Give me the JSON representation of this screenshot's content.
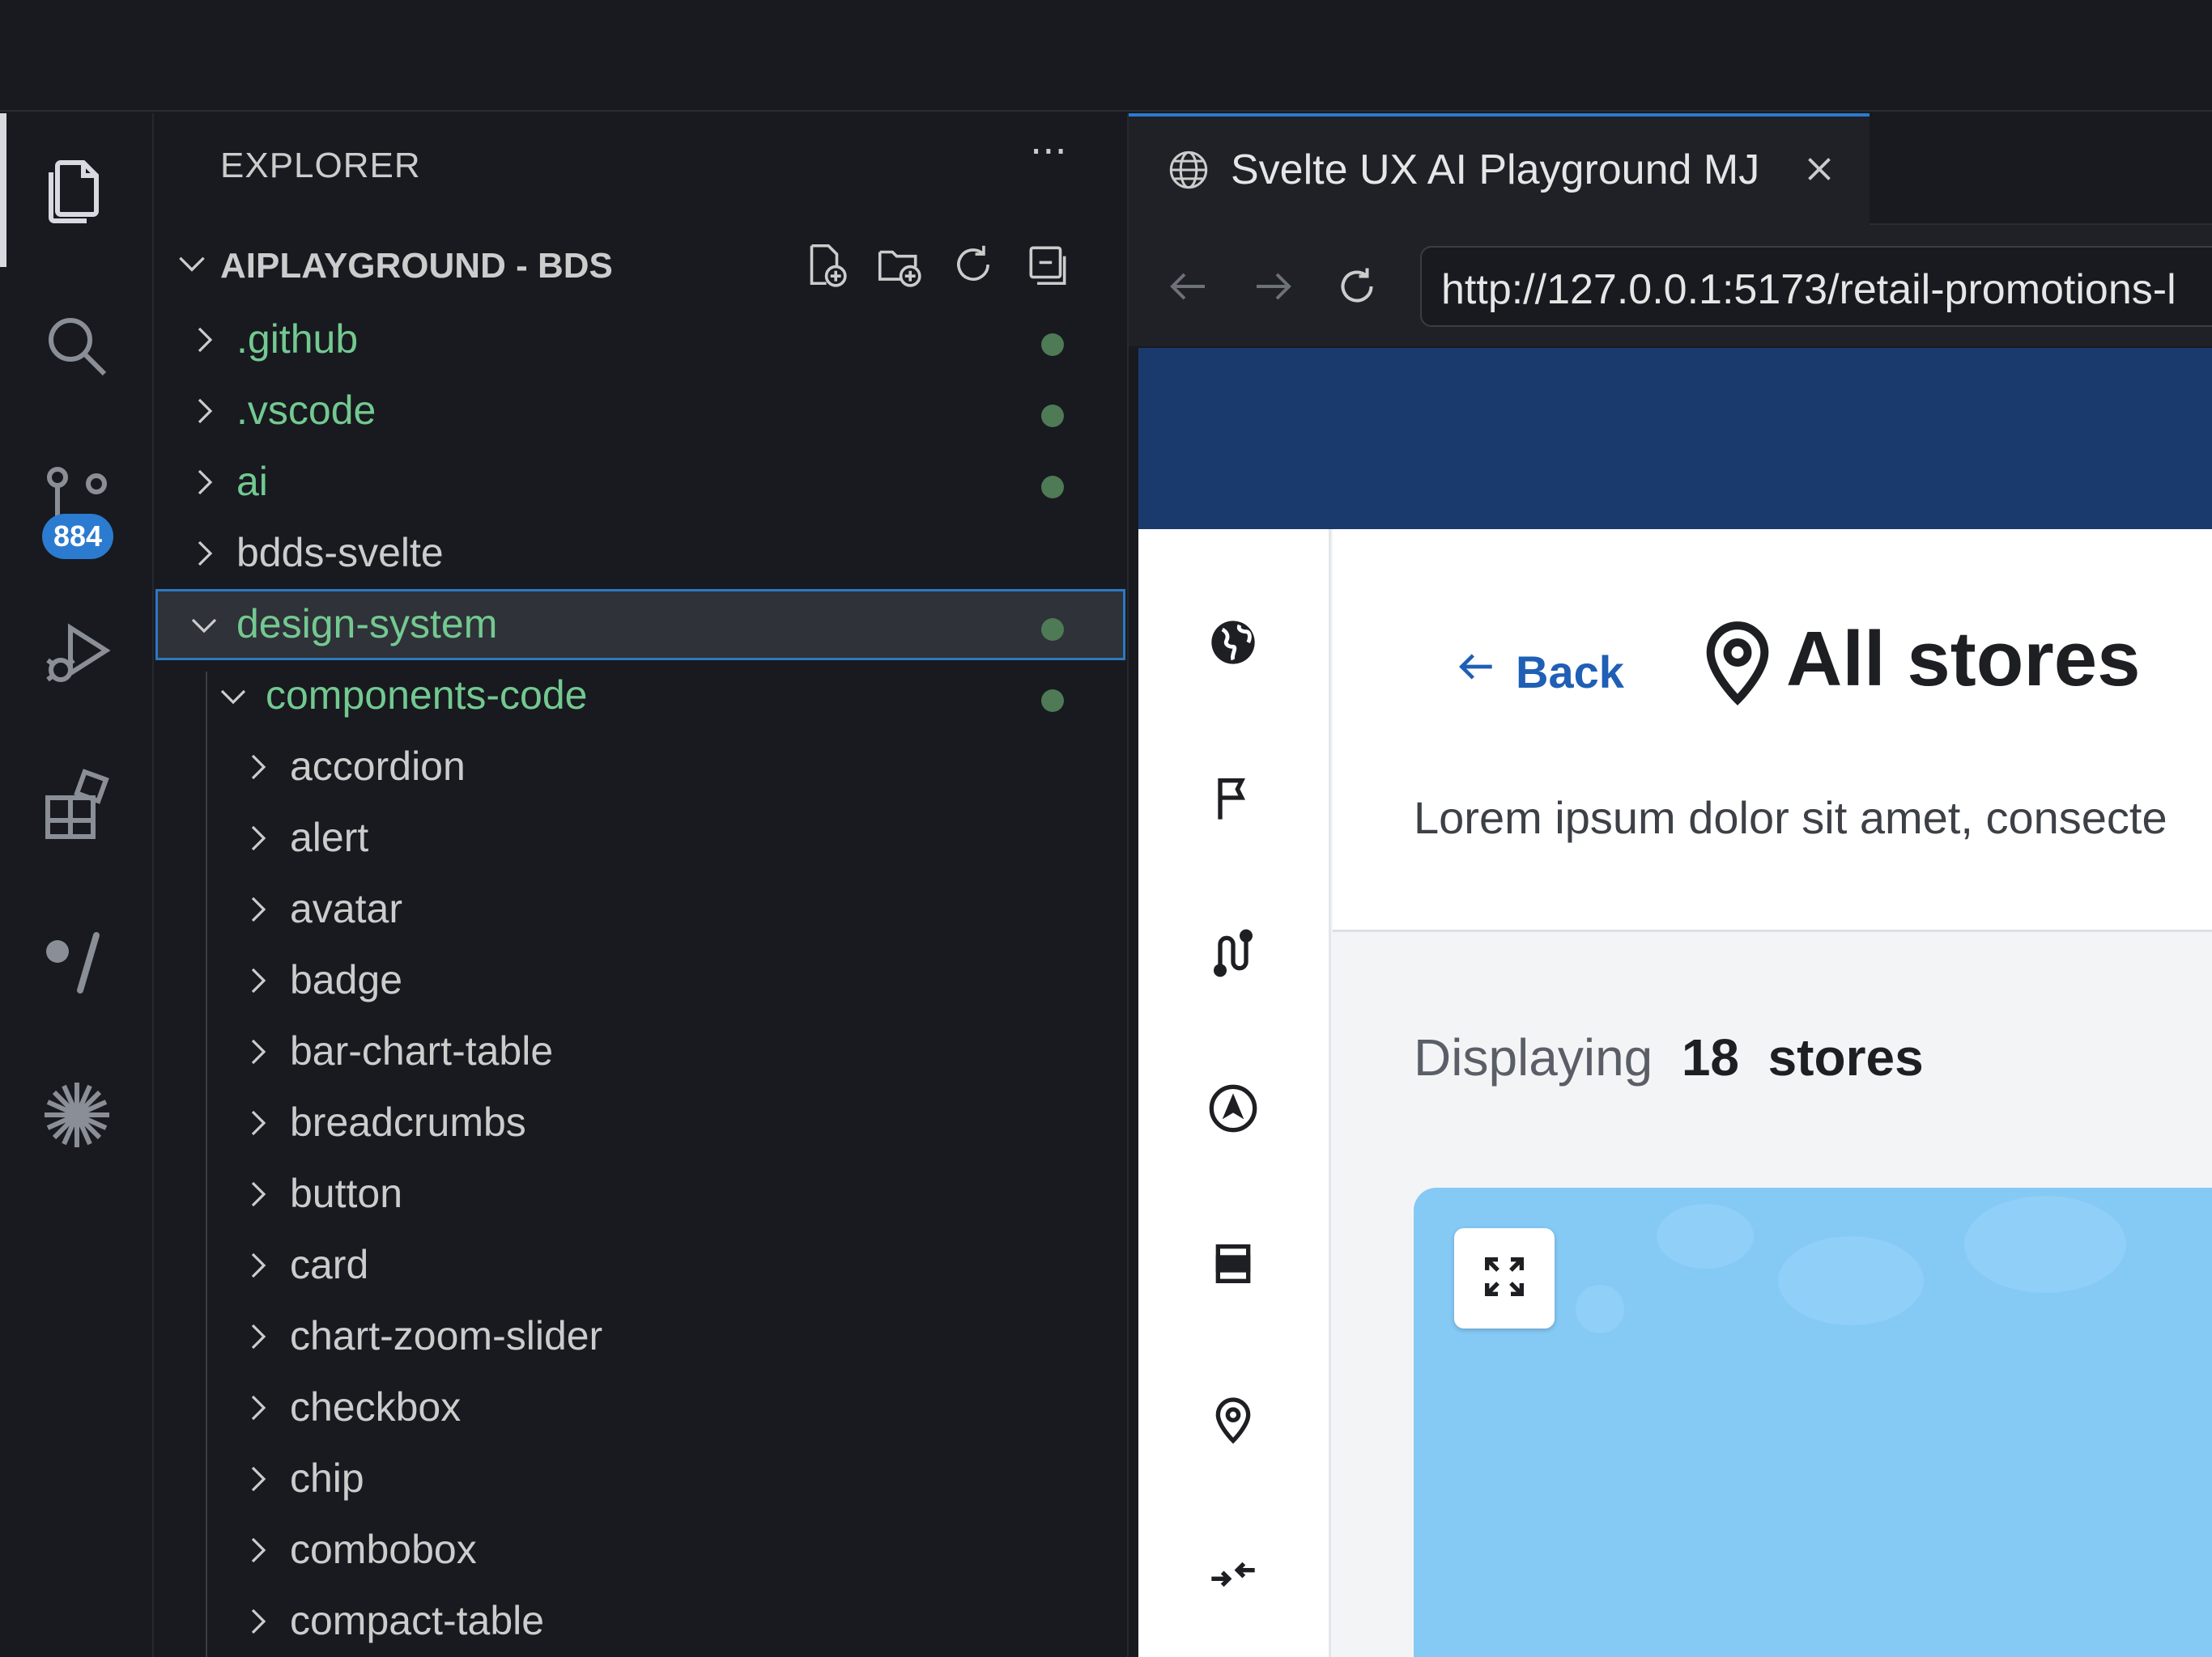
{
  "activity_bar": {
    "source_control_badge": "884",
    "items": [
      "explorer-icon",
      "search-icon",
      "source-control-icon",
      "run-debug-icon",
      "extensions-icon",
      "comment-slash-icon",
      "sparkle-icon"
    ]
  },
  "explorer": {
    "title": "EXPLORER",
    "more": "···",
    "workspace": "AIPLAYGROUND - BDS",
    "tree": [
      {
        "label": ".github",
        "level": 0,
        "expanded": false,
        "modified": true
      },
      {
        "label": ".vscode",
        "level": 0,
        "expanded": false,
        "modified": true
      },
      {
        "label": "ai",
        "level": 0,
        "expanded": false,
        "modified": true
      },
      {
        "label": "bdds-svelte",
        "level": 0,
        "expanded": false,
        "modified": false
      },
      {
        "label": "design-system",
        "level": 0,
        "expanded": true,
        "modified": true,
        "selected": true
      },
      {
        "label": "components-code",
        "level": 1,
        "expanded": true,
        "modified": true
      },
      {
        "label": "accordion",
        "level": 2,
        "expanded": false,
        "modified": false
      },
      {
        "label": "alert",
        "level": 2,
        "expanded": false,
        "modified": false
      },
      {
        "label": "avatar",
        "level": 2,
        "expanded": false,
        "modified": false
      },
      {
        "label": "badge",
        "level": 2,
        "expanded": false,
        "modified": false
      },
      {
        "label": "bar-chart-table",
        "level": 2,
        "expanded": false,
        "modified": false
      },
      {
        "label": "breadcrumbs",
        "level": 2,
        "expanded": false,
        "modified": false
      },
      {
        "label": "button",
        "level": 2,
        "expanded": false,
        "modified": false
      },
      {
        "label": "card",
        "level": 2,
        "expanded": false,
        "modified": false
      },
      {
        "label": "chart-zoom-slider",
        "level": 2,
        "expanded": false,
        "modified": false
      },
      {
        "label": "checkbox",
        "level": 2,
        "expanded": false,
        "modified": false
      },
      {
        "label": "chip",
        "level": 2,
        "expanded": false,
        "modified": false
      },
      {
        "label": "combobox",
        "level": 2,
        "expanded": false,
        "modified": false
      },
      {
        "label": "compact-table",
        "level": 2,
        "expanded": false,
        "modified": false
      }
    ]
  },
  "browser": {
    "tab_title": "Svelte UX AI Playground MJ",
    "url": "http://127.0.0.1:5173/retail-promotions-l"
  },
  "page": {
    "back_label": "Back",
    "heading": "All stores",
    "description": "Lorem ipsum dolor sit amet, consecte",
    "displaying_prefix": "Displaying",
    "store_count": "18",
    "displaying_suffix": "stores"
  },
  "colors": {
    "accent": "#2b7bd0",
    "modified_green": "#73c991",
    "page_header": "#1a3a6e",
    "map_water": "#85c9f5",
    "link_blue": "#1f5fb5"
  }
}
